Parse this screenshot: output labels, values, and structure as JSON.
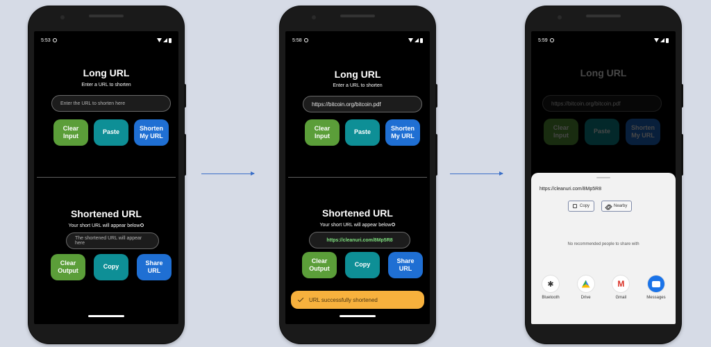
{
  "phone1": {
    "time": "5:53",
    "long_title": "Long URL",
    "long_sub": "Enter a URL to shorten",
    "input_placeholder": "Enter the URL to shorten here",
    "btn_clear_input": "Clear\nInput",
    "btn_paste": "Paste",
    "btn_shorten": "Shorten\nMy URL",
    "short_title": "Shortened URL",
    "short_sub": "Your short URL will appear below",
    "output_placeholder": "The shortened URL will appear here",
    "btn_clear_output": "Clear\nOutput",
    "btn_copy": "Copy",
    "btn_share": "Share\nURL"
  },
  "phone2": {
    "time": "5:58",
    "long_title": "Long URL",
    "long_sub": "Enter a URL to shorten",
    "input_value": "https://bitcoin.org/bitcoin.pdf",
    "btn_clear_input": "Clear\nInput",
    "btn_paste": "Paste",
    "btn_shorten": "Shorten\nMy URL",
    "short_title": "Shortened URL",
    "short_sub": "Your short URL will appear below",
    "output_value": "https://cleanuri.com/8Mp5R8",
    "btn_clear_output": "Clear\nOutput",
    "btn_copy": "Copy",
    "btn_share": "Share\nURL",
    "toast": "URL successfully shortened"
  },
  "phone3": {
    "time": "5:59",
    "long_title": "Long URL",
    "long_sub": "Enter a URL to shorten",
    "input_value": "https://bitcoin.org/bitcoin.pdf",
    "btn_clear_input": "Clear\nInput",
    "btn_paste": "Paste",
    "btn_shorten": "Shorten\nMy URL",
    "sheet": {
      "shared_url": "https://cleanuri.com/8Mp5R8",
      "copy": "Copy",
      "nearby": "Nearby",
      "no_recommendation": "No recommended people to share with",
      "apps": [
        "Bluetooth",
        "Drive",
        "Gmail",
        "Messages"
      ]
    }
  },
  "colors": {
    "green": "#5b9e39",
    "teal": "#0e8f96",
    "blue": "#1f6fd3",
    "toast": "#f7b13d",
    "arrow": "#3b6fc7"
  },
  "icons": [
    "settings-gear-icon",
    "wifi-icon",
    "signal-icon",
    "battery-icon",
    "info-icon",
    "check-icon",
    "copy-icon",
    "nearby-share-icon",
    "bluetooth-icon",
    "drive-icon",
    "gmail-icon",
    "messages-icon",
    "arrow-right-icon"
  ]
}
